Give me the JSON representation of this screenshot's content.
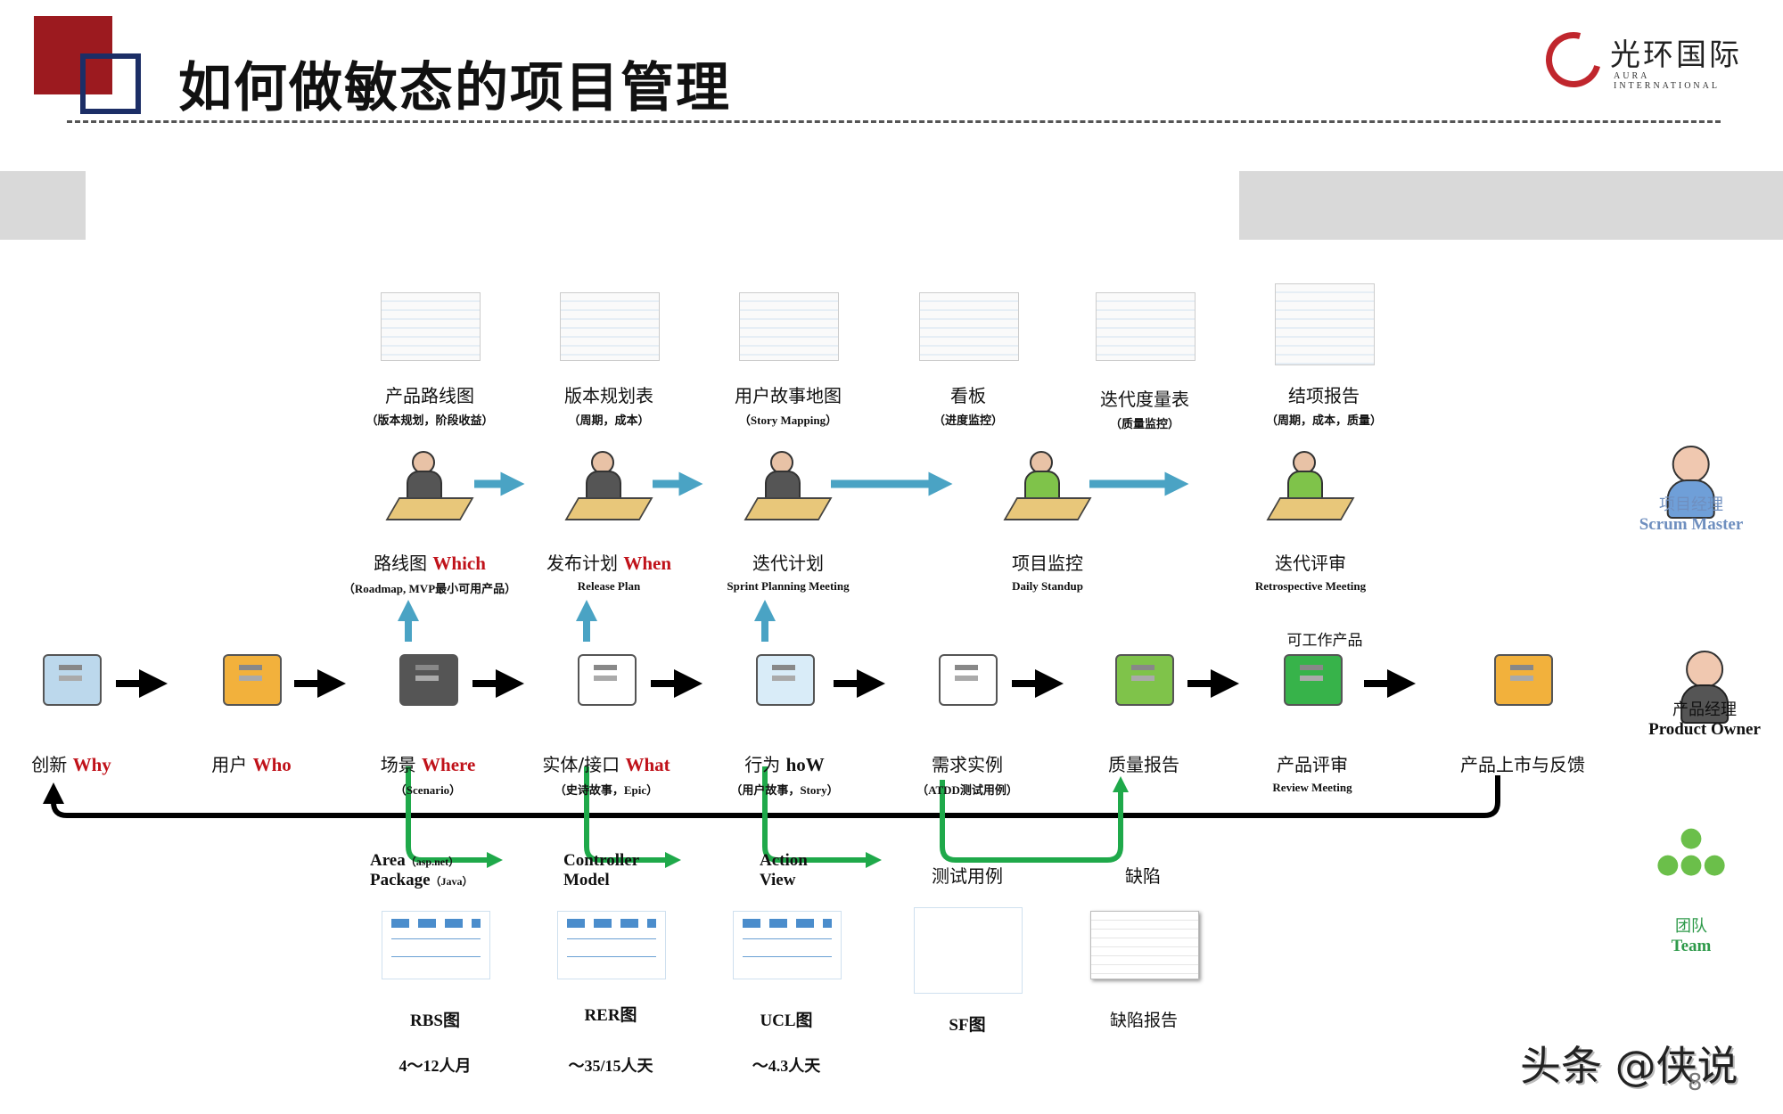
{
  "header": {
    "title": "如何做敏态的项目管理",
    "logo_cn": "光环国际",
    "logo_en": "AURA INTERNATIONAL"
  },
  "colors": {
    "brand_red": "#9c1a1f",
    "brand_navy": "#1c2e66",
    "keyword_red": "#c0121a",
    "flow_blue": "#4aa3c4",
    "flow_green": "#1fa94a",
    "flow_black": "#000000",
    "scrum_master_blue": "#6f8fbf",
    "team_green": "#2e9a4a"
  },
  "artifacts": [
    {
      "title": "产品路线图",
      "sub": "（版本规划，阶段收益）"
    },
    {
      "title": "版本规划表",
      "sub": "（周期，成本）"
    },
    {
      "title": "用户故事地图",
      "sub": "（Story Mapping）"
    },
    {
      "title": "看板",
      "sub": "（进度监控）"
    },
    {
      "title": "迭代度量表",
      "sub": "（质量监控）"
    },
    {
      "title": "结项报告",
      "sub": "（周期，成本，质量）"
    }
  ],
  "ceremonies": [
    {
      "title": "路线图",
      "keyword": "Which",
      "sub": "（Roadmap, MVP最小可用产品）",
      "icon": "planner-desk-icon"
    },
    {
      "title": "发布计划",
      "keyword": "When",
      "sub": "Release Plan",
      "icon": "release-plan-desk-icon"
    },
    {
      "title": "迭代计划",
      "keyword": "",
      "sub": "Sprint Planning Meeting",
      "icon": "meeting-table-icon"
    },
    {
      "title": "项目监控",
      "keyword": "",
      "sub": "Daily Standup",
      "icon": "standup-team-icon"
    },
    {
      "title": "迭代评审",
      "keyword": "",
      "sub": "Retrospective Meeting",
      "icon": "presentation-icon"
    }
  ],
  "flow": [
    {
      "title": "创新",
      "keyword": "Why",
      "sub": "",
      "icon": "documents-coins-icon"
    },
    {
      "title": "用户",
      "keyword": "Who",
      "sub": "",
      "icon": "users-icon"
    },
    {
      "title": "场景",
      "keyword": "Where",
      "sub": "（Scenario）",
      "icon": "lab-scenario-icon"
    },
    {
      "title": "实体/接口",
      "keyword": "What",
      "sub": "（史诗故事，Epic）",
      "icon": "entity-tables-icon"
    },
    {
      "title": "行为",
      "keyword": "hoW",
      "sub": "（用户故事，Story）",
      "icon": "browser-windows-icon"
    },
    {
      "title": "需求实例",
      "keyword": "",
      "sub": "（ATDD测试用例）",
      "icon": "workflow-icon"
    },
    {
      "title": "质量报告",
      "keyword": "",
      "sub": "",
      "icon": "quality-report-icon"
    },
    {
      "title": "产品评审",
      "keyword": "",
      "sub": "Review Meeting",
      "icon": "product-review-icon",
      "note": "可工作产品"
    },
    {
      "title": "产品上市与反馈",
      "keyword": "",
      "sub": "",
      "icon": "market-launch-icon"
    }
  ],
  "branches": [
    {
      "line1": "Area",
      "line1_small": "（asp.net）",
      "line2": "Package",
      "line2_small": "（Java）"
    },
    {
      "line1": "Controller",
      "line1_small": "",
      "line2": "Model",
      "line2_small": ""
    },
    {
      "line1": "Action",
      "line1_small": "",
      "line2": "View",
      "line2_small": ""
    }
  ],
  "test_branch": {
    "left": "测试用例",
    "right": "缺陷"
  },
  "diagrams": [
    {
      "title": "RBS图",
      "effort": "4～12人月"
    },
    {
      "title": "RER图",
      "effort": "～35/15人天"
    },
    {
      "title": "UCL图",
      "effort": "～4.3人天"
    },
    {
      "title": "SF图",
      "effort": ""
    },
    {
      "title": "缺陷报告",
      "effort": ""
    }
  ],
  "roles": [
    {
      "cn": "项目经理",
      "en": "Scrum Master"
    },
    {
      "cn": "产品经理",
      "en": "Product Owner"
    },
    {
      "cn": "团队",
      "en": "Team"
    }
  ],
  "footer": {
    "watermark": "头条 @侠说",
    "page_number": "8"
  }
}
